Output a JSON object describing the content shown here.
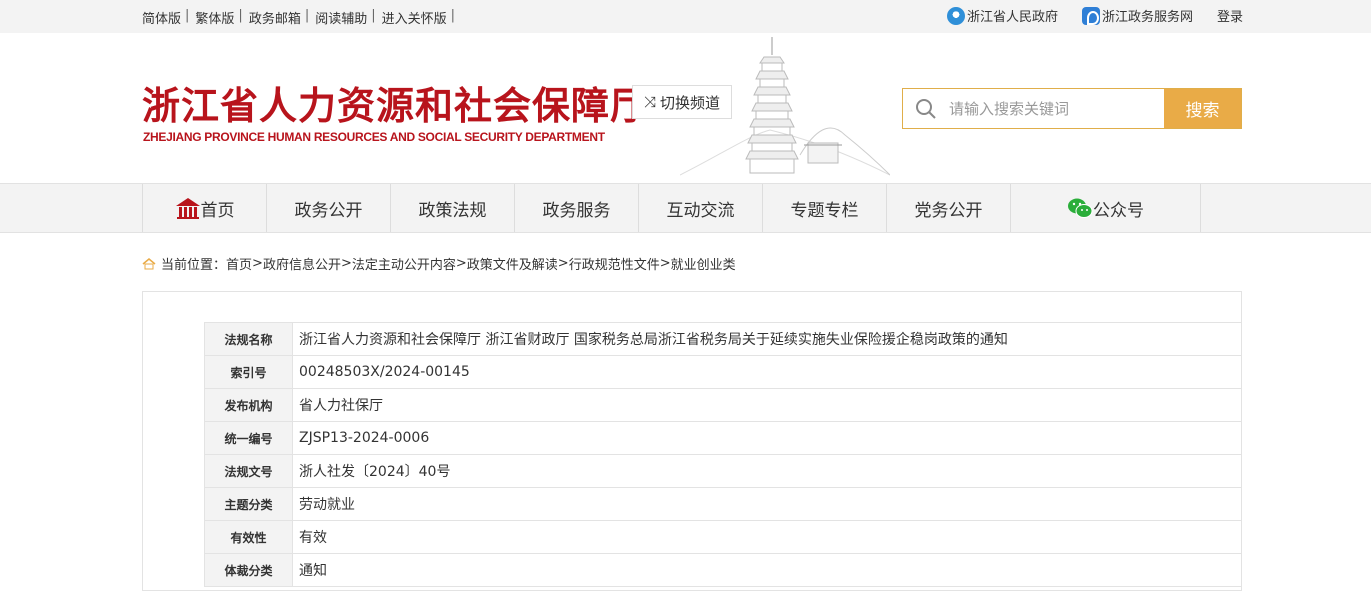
{
  "topbar": {
    "left_links": [
      "简体版",
      "繁体版",
      "政务邮箱",
      "阅读辅助",
      "进入关怀版"
    ],
    "separator": "|",
    "right_links": [
      {
        "label": "浙江省人民政府",
        "icon": "zhejiang-gov-icon"
      },
      {
        "label": "浙江政务服务网",
        "icon": "gov-service-icon"
      }
    ],
    "login": "登录"
  },
  "header": {
    "title_cn": "浙江省人力资源和社会保障厅",
    "title_en": "ZHEJIANG PROVINCE HUMAN RESOURCES AND SOCIAL SECURITY DEPARTMENT",
    "switch_label": "切换频道",
    "search_placeholder": "请输入搜索关键词",
    "search_button": "搜索",
    "brand_color": "#b8141c",
    "accent_color": "#e9ab47"
  },
  "nav": {
    "items": [
      "首页",
      "政务公开",
      "政策法规",
      "政务服务",
      "互动交流",
      "专题专栏",
      "党务公开",
      "公众号"
    ]
  },
  "breadcrumb": {
    "prefix": "当前位置：",
    "items": [
      "首页",
      "政府信息公开",
      "法定主动公开内容",
      "政策文件及解读",
      "行政规范性文件",
      "就业创业类"
    ],
    "separator": ">"
  },
  "meta": {
    "rows": [
      {
        "key": "法规名称",
        "value": "浙江省人力资源和社会保障厅 浙江省财政厅 国家税务总局浙江省税务局关于延续实施失业保险援企稳岗政策的通知"
      },
      {
        "key": "索引号",
        "value": "00248503X/2024-00145"
      },
      {
        "key": "发布机构",
        "value": "省人力社保厅"
      },
      {
        "key": "统一编号",
        "value": "ZJSP13-2024-0006"
      },
      {
        "key": "法规文号",
        "value": "浙人社发〔2024〕40号"
      },
      {
        "key": "主题分类",
        "value": "劳动就业"
      },
      {
        "key": "有效性",
        "value": "有效"
      },
      {
        "key": "体裁分类",
        "value": "通知"
      }
    ]
  }
}
